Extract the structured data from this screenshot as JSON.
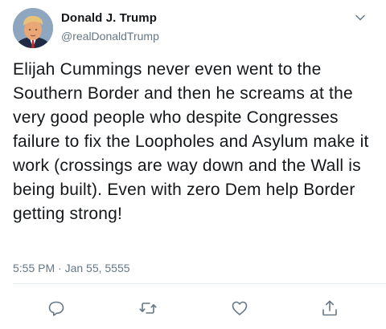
{
  "author": {
    "display_name": "Donald J. Trump",
    "handle": "@realDonaldTrump"
  },
  "tweet": {
    "text": "Elijah Cummings never even went to the Southern Border and then he screams at the very good people who despite Congresses failure to fix the Loopholes and Asylum make it work (crossings are way down and the Wall is being built). Even with zero Dem help Border getting strong!",
    "timestamp": "5:55 PM · Jan 55, 5555"
  },
  "icons": {
    "caret": "chevron-down-icon",
    "reply": "reply-icon",
    "retweet": "retweet-icon",
    "like": "heart-icon",
    "share": "share-icon"
  },
  "colors": {
    "text_primary": "#14171a",
    "text_secondary": "#657786",
    "icon": "#657786",
    "divider": "#e6ecf0"
  }
}
